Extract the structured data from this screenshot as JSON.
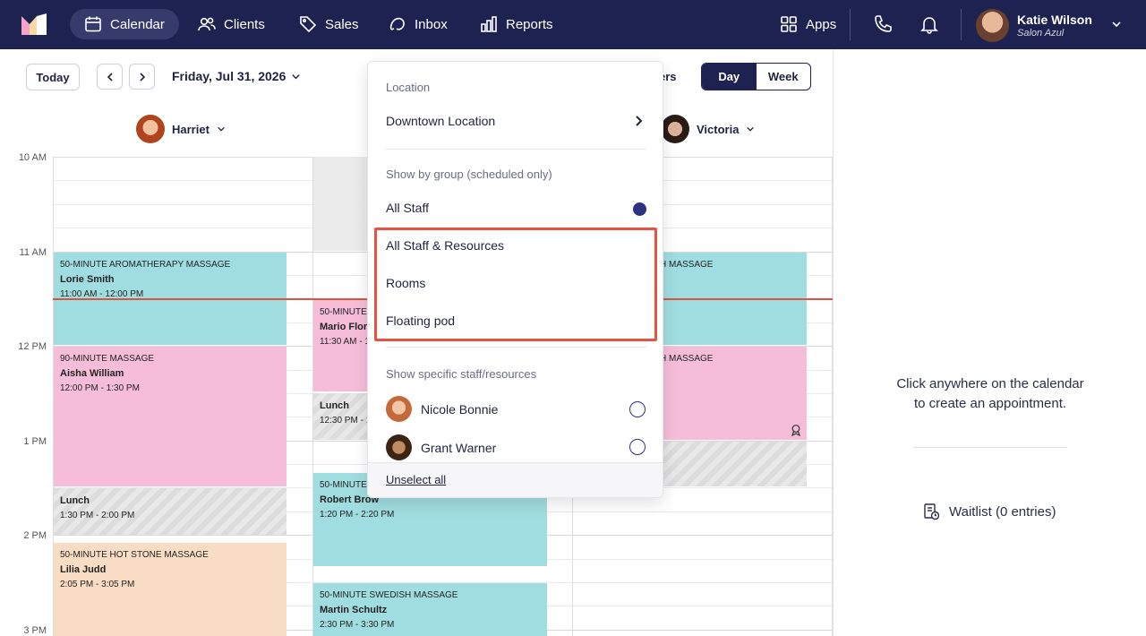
{
  "nav": {
    "items": [
      {
        "label": "Calendar",
        "icon": "calendar-icon"
      },
      {
        "label": "Clients",
        "icon": "users-icon"
      },
      {
        "label": "Sales",
        "icon": "tag-icon"
      },
      {
        "label": "Inbox",
        "icon": "inbox-icon"
      },
      {
        "label": "Reports",
        "icon": "bar-chart-icon"
      }
    ],
    "apps_label": "Apps",
    "user_name": "Katie Wilson",
    "user_salon": "Salon Azul"
  },
  "toolbar": {
    "today": "Today",
    "date": "Friday, Jul 31, 2026",
    "filters_partial": "ers",
    "view_day": "Day",
    "view_week": "Week"
  },
  "staff": [
    "Harriet",
    "Victoria"
  ],
  "time_labels": [
    "10 AM",
    "11 AM",
    "12 PM",
    "1 PM",
    "2 PM",
    "3 PM"
  ],
  "appointments": [
    {
      "service": "50-MINUTE AROMATHERAPY MASSAGE",
      "client": "Lorie Smith",
      "time": "11:00 AM - 12:00 PM"
    },
    {
      "service": "90-MINUTE MASSAGE",
      "client": "Aisha William",
      "time": "12:00 PM - 1:30 PM"
    },
    {
      "service": "Lunch",
      "client": "",
      "time": "1:30 PM - 2:00 PM"
    },
    {
      "service": "50-MINUTE HOT STONE MASSAGE",
      "client": "Lilia Judd",
      "time": "2:05 PM - 3:05 PM"
    },
    {
      "service": "50-MINUTE",
      "client": "Mario Flore",
      "time": "11:30 AM - 1"
    },
    {
      "service": "Lunch",
      "client": "",
      "time": "12:30 PM - 1"
    },
    {
      "service": "50-MINUTE",
      "client": "Robert Brow",
      "time": "1:20 PM - 2:20 PM"
    },
    {
      "service": "50-MINUTE SWEDISH MASSAGE",
      "client": "Martin Schultz",
      "time": "2:30 PM - 3:30 PM"
    },
    {
      "service": "H MASSAGE",
      "client": "",
      "time": ""
    },
    {
      "service": "H MASSAGE",
      "client": "",
      "time": ""
    }
  ],
  "dropdown": {
    "location_heading": "Location",
    "location_value": "Downtown Location",
    "group_heading": "Show by group (scheduled only)",
    "groups": [
      "All Staff",
      "All Staff & Resources",
      "Rooms",
      "Floating pod"
    ],
    "specific_heading": "Show specific staff/resources",
    "staff": [
      "Nicole Bonnie",
      "Grant Warner"
    ],
    "unselect": "Unselect all"
  },
  "right_panel": {
    "message": "Click anywhere on the calendar to create an appointment.",
    "waitlist": "Waitlist (0 entries)"
  }
}
